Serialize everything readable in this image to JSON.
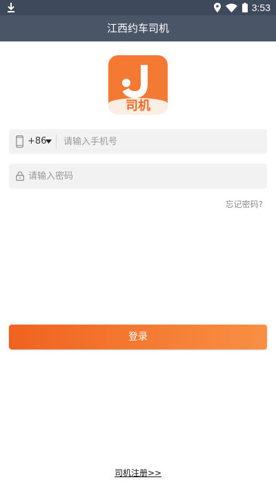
{
  "status_bar": {
    "time": "3:53",
    "icons": [
      "download-icon",
      "location-icon",
      "wifi-icon",
      "battery-icon"
    ]
  },
  "header": {
    "title": "江西约车司机"
  },
  "logo": {
    "text": "司机",
    "colors": {
      "primary": "#f47a34",
      "bottom": "#fdeee4"
    }
  },
  "phone_field": {
    "icon": "phone-icon",
    "country_code": "+86",
    "placeholder": "请输入手机号",
    "value": ""
  },
  "password_field": {
    "icon": "lock-icon",
    "placeholder": "请输入密码",
    "value": ""
  },
  "forgot_password": {
    "label": "忘记密码?"
  },
  "login_button": {
    "label": "登录",
    "gradient": [
      "#f0621f",
      "#f89044"
    ]
  },
  "register_link": {
    "label": "司机注册>>"
  }
}
